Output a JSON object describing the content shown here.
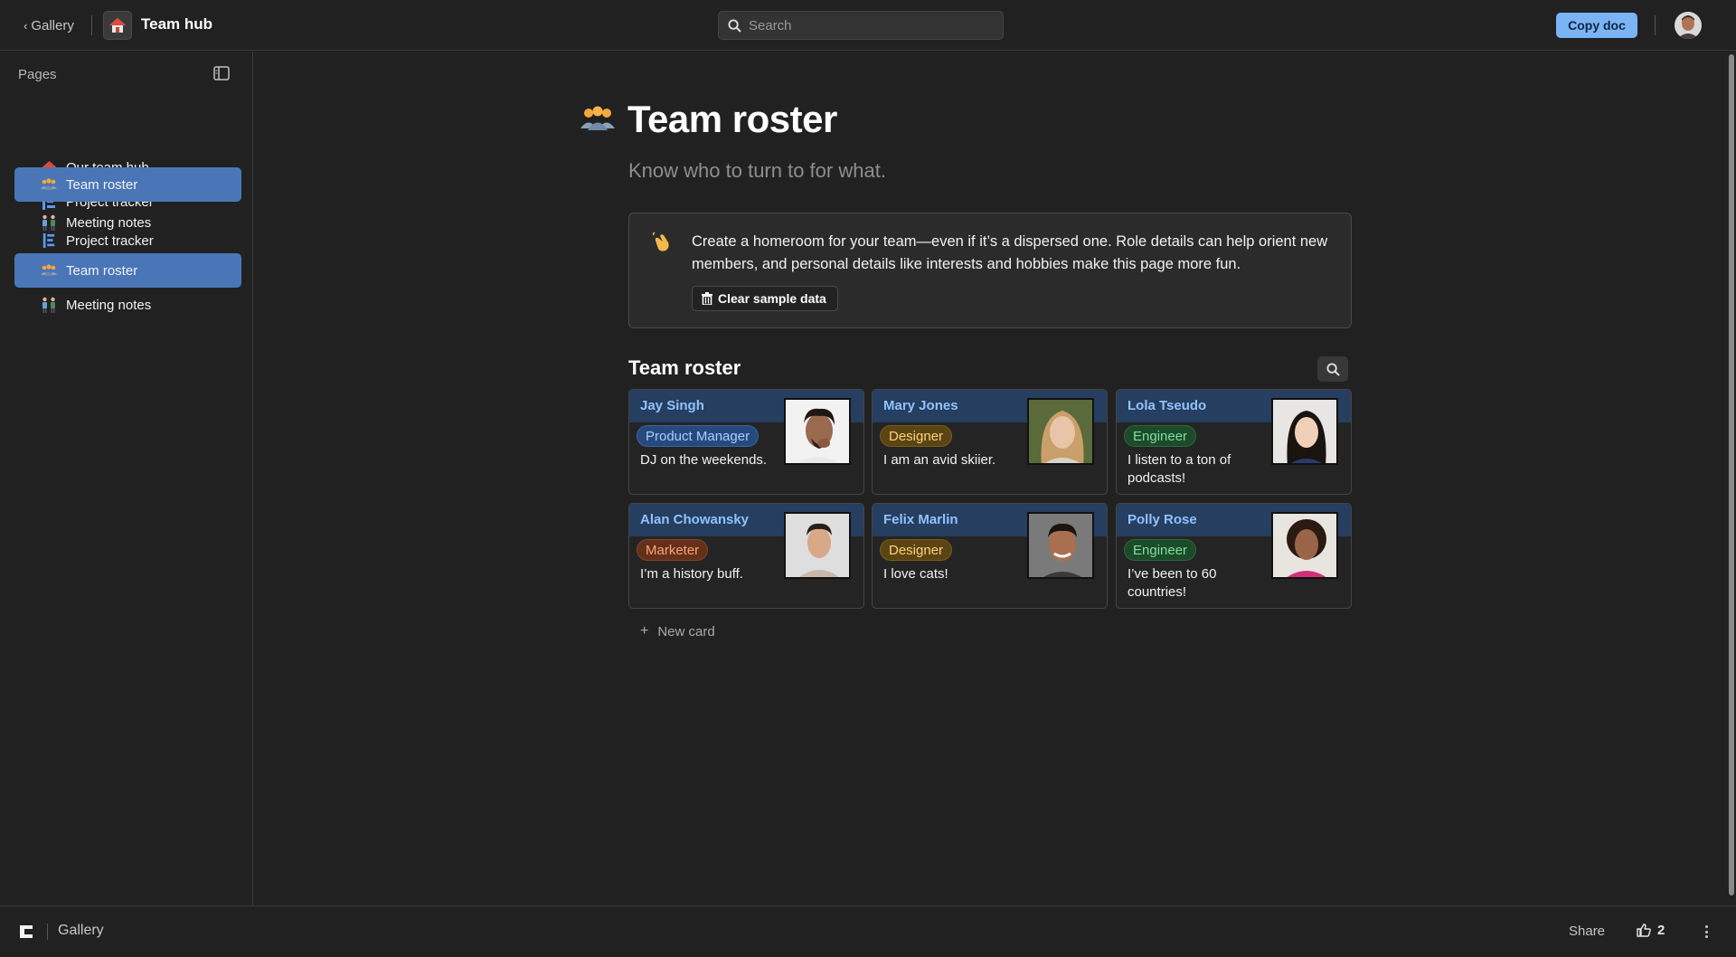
{
  "topbar": {
    "back_label": "Gallery",
    "doc_title": "Team hub",
    "search_placeholder": "Search",
    "copy_label": "Copy doc"
  },
  "sidebar": {
    "title": "Pages",
    "items": [
      {
        "label": "Our team hub",
        "icon": "house-icon",
        "active": false
      },
      {
        "label": "Project tracker",
        "icon": "tracker-icon",
        "active": false
      },
      {
        "label": "Team roster",
        "icon": "people-icon",
        "active": true
      },
      {
        "label": "Meeting notes",
        "icon": "meeting-icon",
        "active": false
      },
      {
        "label": "Project tracker",
        "icon": "tracker-icon",
        "active": false
      },
      {
        "label": "Team roster",
        "icon": "people-icon",
        "active": true
      },
      {
        "label": "Meeting notes",
        "icon": "meeting-icon",
        "active": false
      }
    ]
  },
  "main": {
    "title": "Team roster",
    "subtitle": "Know who to turn to for what.",
    "callout": {
      "text": "Create a homeroom for your team—even if it’s a dispersed one. Role details can help orient new members, and personal details like interests and hobbies make this page more fun.",
      "button": "Clear sample data"
    },
    "section_title": "Team roster",
    "new_card_label": "New card",
    "cards": [
      {
        "name": "Jay Singh",
        "role": "Product Manager",
        "role_color": "blue",
        "desc": "DJ on the weekends."
      },
      {
        "name": "Mary Jones",
        "role": "Designer",
        "role_color": "amber",
        "desc": "I am an avid skiier."
      },
      {
        "name": "Lola Tseudo",
        "role": "Engineer",
        "role_color": "green",
        "desc": "I listen to a ton of podcasts!"
      },
      {
        "name": "Alan Chowansky",
        "role": "Marketer",
        "role_color": "orange",
        "desc": "I’m a history buff."
      },
      {
        "name": "Felix Marlin",
        "role": "Designer",
        "role_color": "amber",
        "desc": "I love cats!"
      },
      {
        "name": "Polly Rose",
        "role": "Engineer",
        "role_color": "green",
        "desc": "I’ve been to 60 countries!"
      }
    ]
  },
  "footer": {
    "gallery_label": "Gallery",
    "share_label": "Share",
    "likes_count": "2"
  },
  "colors": {
    "accent": "#7ab4f5",
    "active_nav": "#4a76b8",
    "card_band": "#263e5f",
    "background": "#212121"
  }
}
